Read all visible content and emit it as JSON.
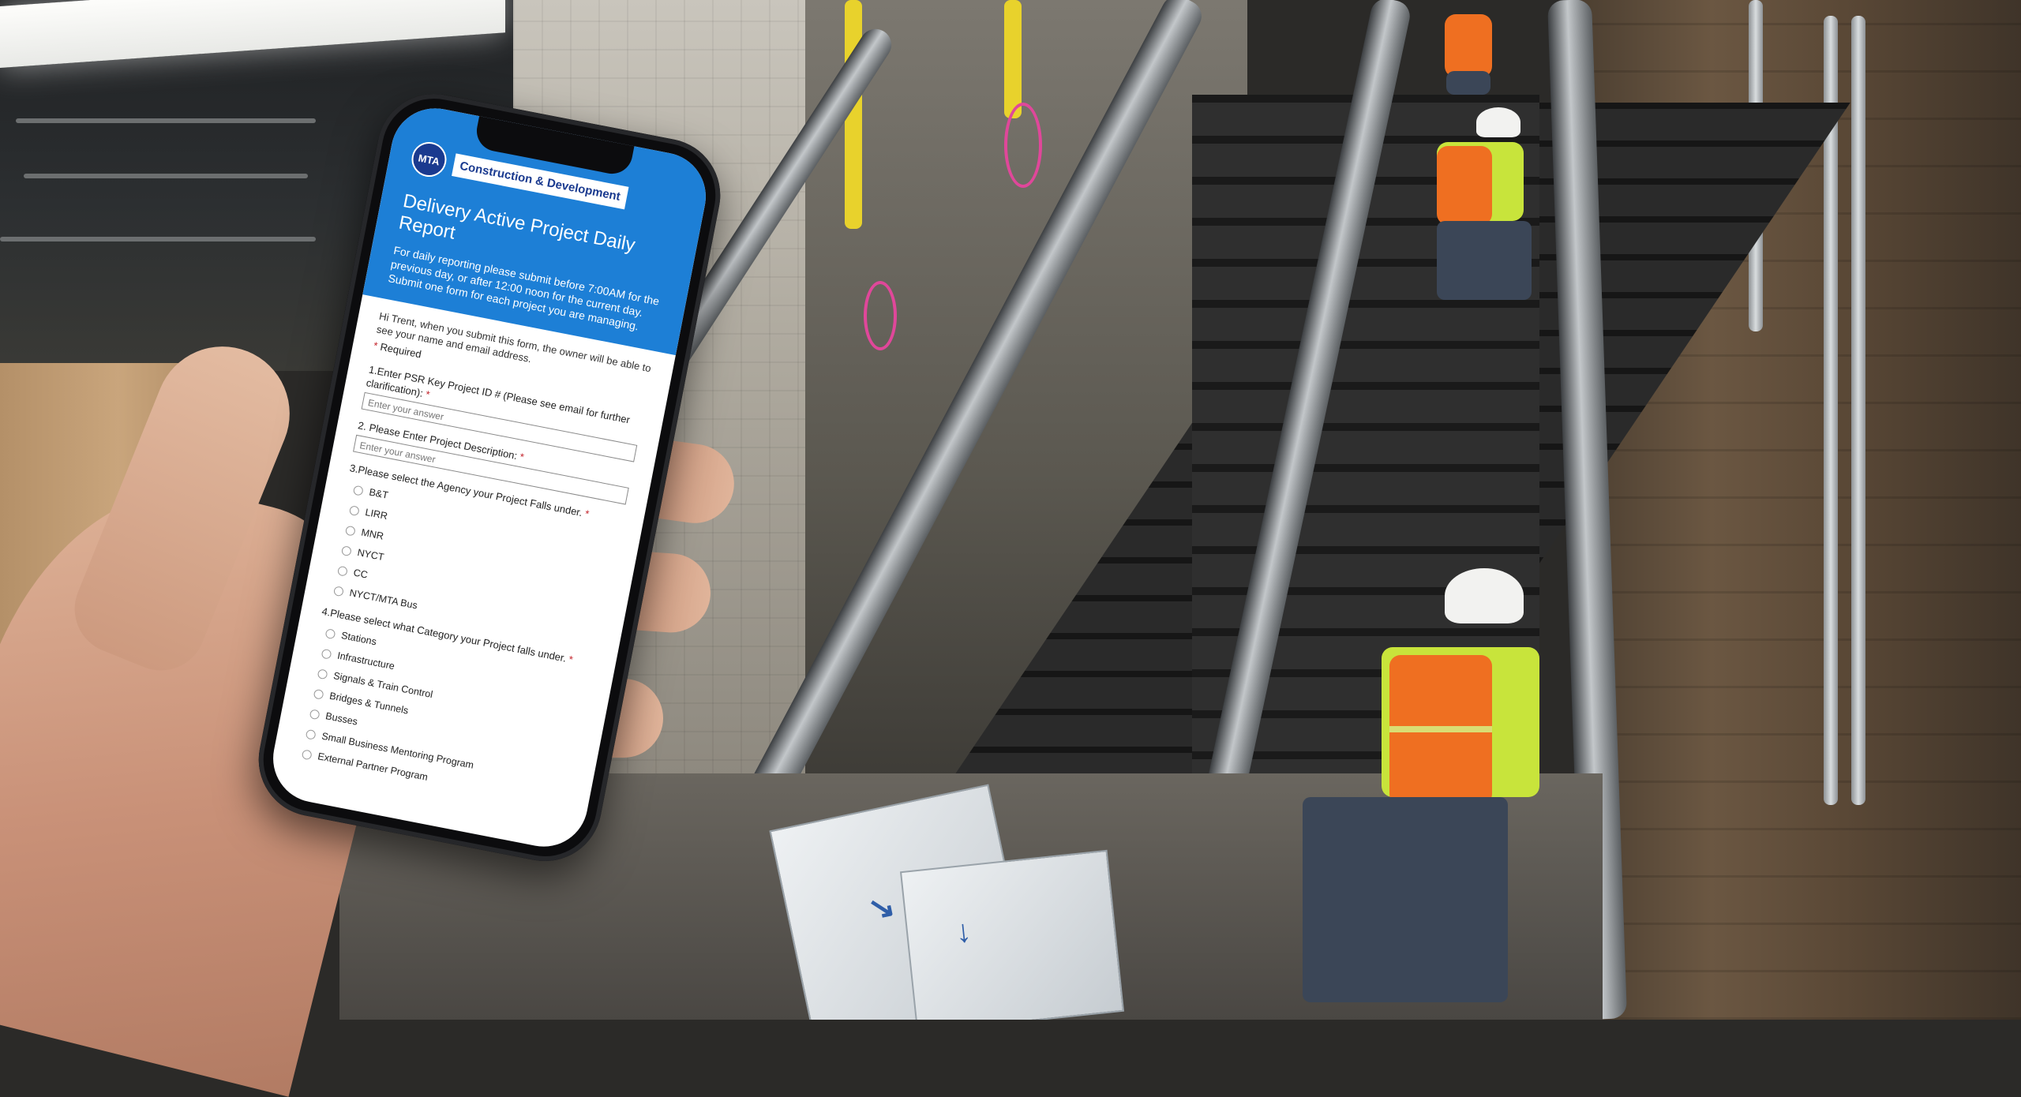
{
  "form": {
    "brand_logo_text": "MTA",
    "brand_name": "Construction & Development",
    "title": "Delivery Active Project Daily Report",
    "description": "For daily reporting please submit before 7:00AM for the previous day, or after 12:00 noon for the current day.  Submit one form for each project you are managing.",
    "intro": "Hi Trent, when you submit this form, the owner will be able to see your name and email address.",
    "required_label": "Required",
    "questions": [
      {
        "label": "1.Enter PSR Key Project ID # (Please see email for further clarification):",
        "placeholder": "Enter your answer"
      },
      {
        "label": "2. Please Enter Project Description:",
        "placeholder": "Enter your answer"
      },
      {
        "label": "3.Please select the Agency your Project Falls under.",
        "options": [
          "B&T",
          "LIRR",
          "MNR",
          "NYCT",
          "CC",
          "NYCT/MTA Bus"
        ]
      },
      {
        "label": "4.Please select what Category your Project falls under.",
        "options": [
          "Stations",
          "Infrastructure",
          "Signals & Train Control",
          "Bridges & Tunnels",
          "Busses",
          "Small Business Mentoring Program",
          "External Partner Program"
        ]
      }
    ]
  },
  "colors": {
    "header_blue": "#1d7fd6",
    "required_red": "#c4262e",
    "vest_orange": "#ef6f21",
    "hi_vis_yellow": "#c8e43b"
  }
}
